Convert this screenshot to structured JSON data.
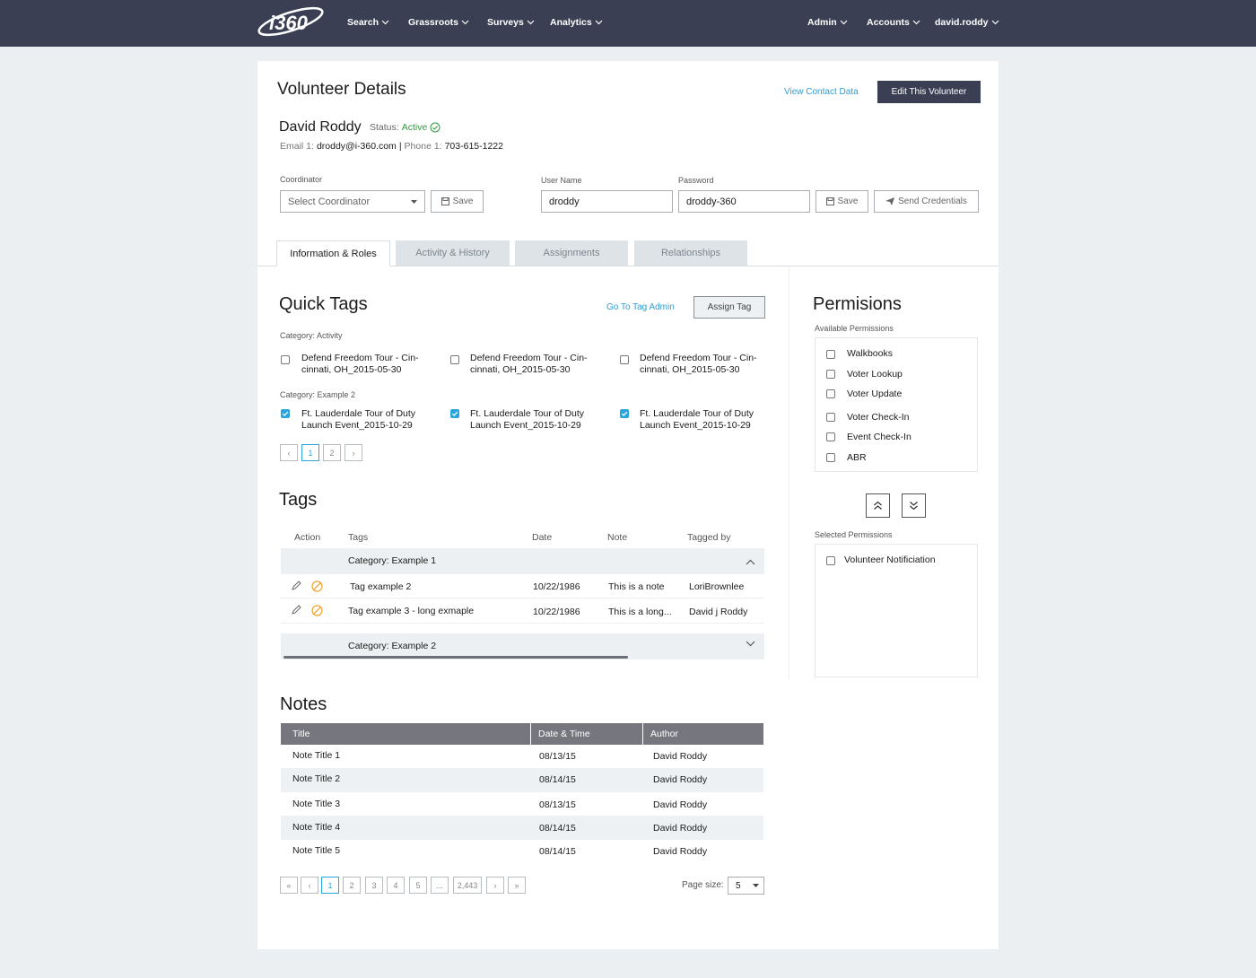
{
  "nav": {
    "logo": "i360",
    "items": [
      "Search",
      "Grassroots",
      "Surveys",
      "Analytics"
    ],
    "right": [
      "Admin",
      "Accounts",
      "david.roddy"
    ]
  },
  "header": {
    "title": "Volunteer Details",
    "view_contact": "View Contact Data",
    "edit_button": "Edit This Volunteer"
  },
  "volunteer": {
    "name": "David Roddy",
    "status_label": "Status:",
    "status_value": "Active",
    "email_label": "Email 1:",
    "email": "droddy@i-360.com",
    "separator": "|",
    "phone_label": "Phone 1:",
    "phone": "703-615-1222"
  },
  "coordinator": {
    "label": "Coordinator",
    "placeholder": "Select Coordinator",
    "save": "Save"
  },
  "credentials": {
    "username_label": "User Name",
    "username": "droddy",
    "password_label": "Password",
    "password": "droddy-360",
    "save": "Save",
    "send": "Send Credentials"
  },
  "tabs": [
    "Information & Roles",
    "Activity & History",
    "Assignments",
    "Relationships"
  ],
  "quick_tags": {
    "title": "Quick Tags",
    "admin_link": "Go To Tag Admin",
    "assign_button": "Assign Tag",
    "categories": [
      {
        "label": "Category: Activity",
        "items": [
          {
            "line1": "Defend Freedom Tour - Cin-",
            "line2": "cinnati, OH_2015-05-30",
            "checked": false
          },
          {
            "line1": "Defend Freedom Tour - Cin-",
            "line2": "cinnati, OH_2015-05-30",
            "checked": false
          },
          {
            "line1": "Defend Freedom Tour - Cin-",
            "line2": "cinnati, OH_2015-05-30",
            "checked": false
          }
        ]
      },
      {
        "label": "Category: Example 2",
        "items": [
          {
            "line1": "Ft. Lauderdale Tour of Duty",
            "line2": "Launch Event_2015-10-29",
            "checked": true
          },
          {
            "line1": "Ft. Lauderdale Tour of Duty",
            "line2": "Launch Event_2015-10-29",
            "checked": true
          },
          {
            "line1": "Ft. Lauderdale Tour of Duty",
            "line2": "Launch Event_2015-10-29",
            "checked": true
          }
        ]
      }
    ],
    "pages": [
      "1",
      "2"
    ],
    "prev": "‹",
    "next": "›"
  },
  "tags": {
    "title": "Tags",
    "columns": [
      "Action",
      "Tags",
      "Date",
      "Note",
      "Tagged by"
    ],
    "category1": "Category: Example 1",
    "rows": [
      {
        "tag": "Tag example 2",
        "date": "10/22/1986",
        "note": "This is a note",
        "by": "LoriBrownlee"
      },
      {
        "tag": "Tag example 3 - long exmaple",
        "date": "10/22/1986",
        "note": "This is a long...",
        "by": "David j Roddy"
      }
    ],
    "category2": "Category: Example 2"
  },
  "notes": {
    "title": "Notes",
    "columns": [
      "Title",
      "Date & Time",
      "Author"
    ],
    "rows": [
      {
        "title": "Note Title 1",
        "date": "08/13/15",
        "author": "David Roddy"
      },
      {
        "title": "Note Title 2",
        "date": "08/14/15",
        "author": "David Roddy"
      },
      {
        "title": "Note Title 3",
        "date": "08/13/15",
        "author": "David Roddy"
      },
      {
        "title": "Note Title 4",
        "date": "08/14/15",
        "author": "David Roddy"
      },
      {
        "title": "Note Title 5",
        "date": "08/14/15",
        "author": "David Roddy"
      }
    ],
    "pagination": {
      "first": "«",
      "prev": "‹",
      "pages": [
        "1",
        "2",
        "3",
        "4",
        "5",
        "...",
        "2,443"
      ],
      "next": "›",
      "last": "»",
      "page_size_label": "Page size:",
      "page_size": "5"
    }
  },
  "permissions": {
    "title": "Permisions",
    "available_label": "Available Permissions",
    "available": [
      "Walkbooks",
      "Voter Lookup",
      "Voter Update",
      "Voter Check-In",
      "Event Check-In",
      "ABR"
    ],
    "selected_label": "Selected Permissions",
    "selected": [
      "Volunteer Notificiation"
    ]
  },
  "colors": {
    "topbar": "#3b3f54",
    "accent": "#2aa6dc",
    "active_status": "#2e9a3e",
    "cancel_icon": "#f0a030",
    "notes_header": "#76767e"
  }
}
